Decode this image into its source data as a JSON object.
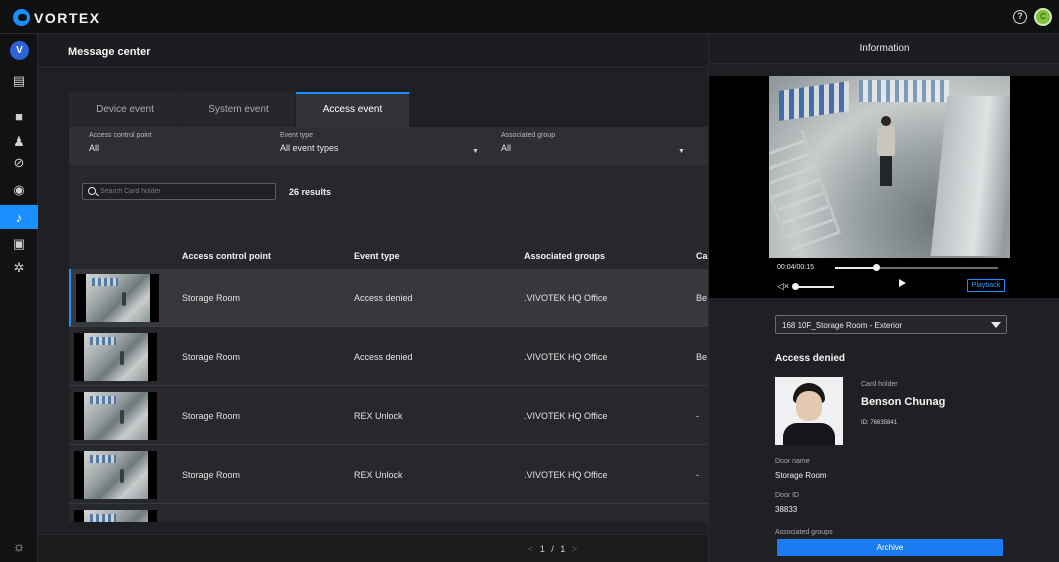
{
  "app": {
    "name": "VORTEX",
    "rail_avatar": "V",
    "user_initial": "C",
    "accent": "#1b8fff"
  },
  "topbar": {
    "help_icon": "help-circle-icon"
  },
  "rail": {
    "items": [
      {
        "icon": "dashboard-icon",
        "glyph": "▤"
      },
      {
        "icon": "camera-icon",
        "glyph": "■"
      },
      {
        "icon": "person-icon",
        "glyph": "♟"
      },
      {
        "icon": "tag-icon",
        "glyph": "⊘"
      },
      {
        "icon": "user-circle-icon",
        "glyph": "◉"
      },
      {
        "icon": "bell-icon",
        "glyph": "♪"
      },
      {
        "icon": "archive-icon",
        "glyph": "▣"
      },
      {
        "icon": "gear-icon",
        "glyph": "✲"
      }
    ],
    "bottom_glyph": "☼"
  },
  "message_center": {
    "title": "Message center",
    "tabs": [
      "Device event",
      "System event",
      "Access event"
    ],
    "active_tab": "Access event",
    "filters": [
      {
        "label": "Access control point",
        "value": "All"
      },
      {
        "label": "Event type",
        "value": "All event types"
      },
      {
        "label": "Associated group",
        "value": "All"
      }
    ],
    "search": {
      "placeholder": "Search Card holder",
      "value": ""
    },
    "results": "26 results",
    "columns": [
      "Access control point",
      "Event type",
      "Associated groups",
      "Ca"
    ],
    "rows": [
      {
        "point": "Storage Room",
        "event": "Access denied",
        "group": ".VIVOTEK HQ Office",
        "extra": "Be"
      },
      {
        "point": "Storage Room",
        "event": "Access denied",
        "group": ".VIVOTEK HQ Office",
        "extra": "Be"
      },
      {
        "point": "Storage Room",
        "event": "REX Unlock",
        "group": ".VIVOTEK HQ Office",
        "extra": "-"
      },
      {
        "point": "Storage Room",
        "event": "REX Unlock",
        "group": ".VIVOTEK HQ Office",
        "extra": "-"
      }
    ],
    "pager": {
      "prev": "<",
      "page": "1 / 1",
      "next": ">"
    }
  },
  "information": {
    "title": "Information",
    "player": {
      "time": "00:04/00:15",
      "progress": 0.25,
      "playback_label": "Playback"
    },
    "camera": "168 10F_Storage Room - Exterior",
    "event_title": "Access denied",
    "card_holder_label": "Card holder",
    "card_holder_name": "Benson Chunag",
    "card_holder_id": "ID: 76635841",
    "door_name_label": "Door name",
    "door_name": "Storage Room",
    "door_id_label": "Door ID",
    "door_id": "38833",
    "groups_label": "Associated groups",
    "archive_label": "Archive"
  }
}
